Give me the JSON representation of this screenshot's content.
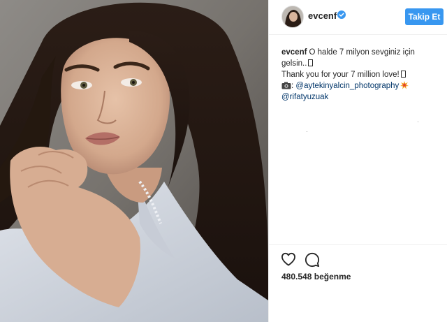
{
  "header": {
    "username": "evcenf",
    "verified_icon": "verified-badge-icon",
    "follow_label": "Takip Et",
    "accent": "#3897f0"
  },
  "caption": {
    "username": "evcenf",
    "line1_text": "O halde 7 milyon sevginiz için gelsin..",
    "line2_text": "Thank you for your 7 million love!",
    "credit_prefix": ":",
    "photographer": "@aytekinyalcin_photography",
    "stylist": "@rifatyuzuak",
    "link_color": "#003569"
  },
  "actions": {
    "like_icon": "heart-icon",
    "comment_icon": "comment-icon"
  },
  "likes": {
    "count": "480.548",
    "label": "beğenme"
  }
}
